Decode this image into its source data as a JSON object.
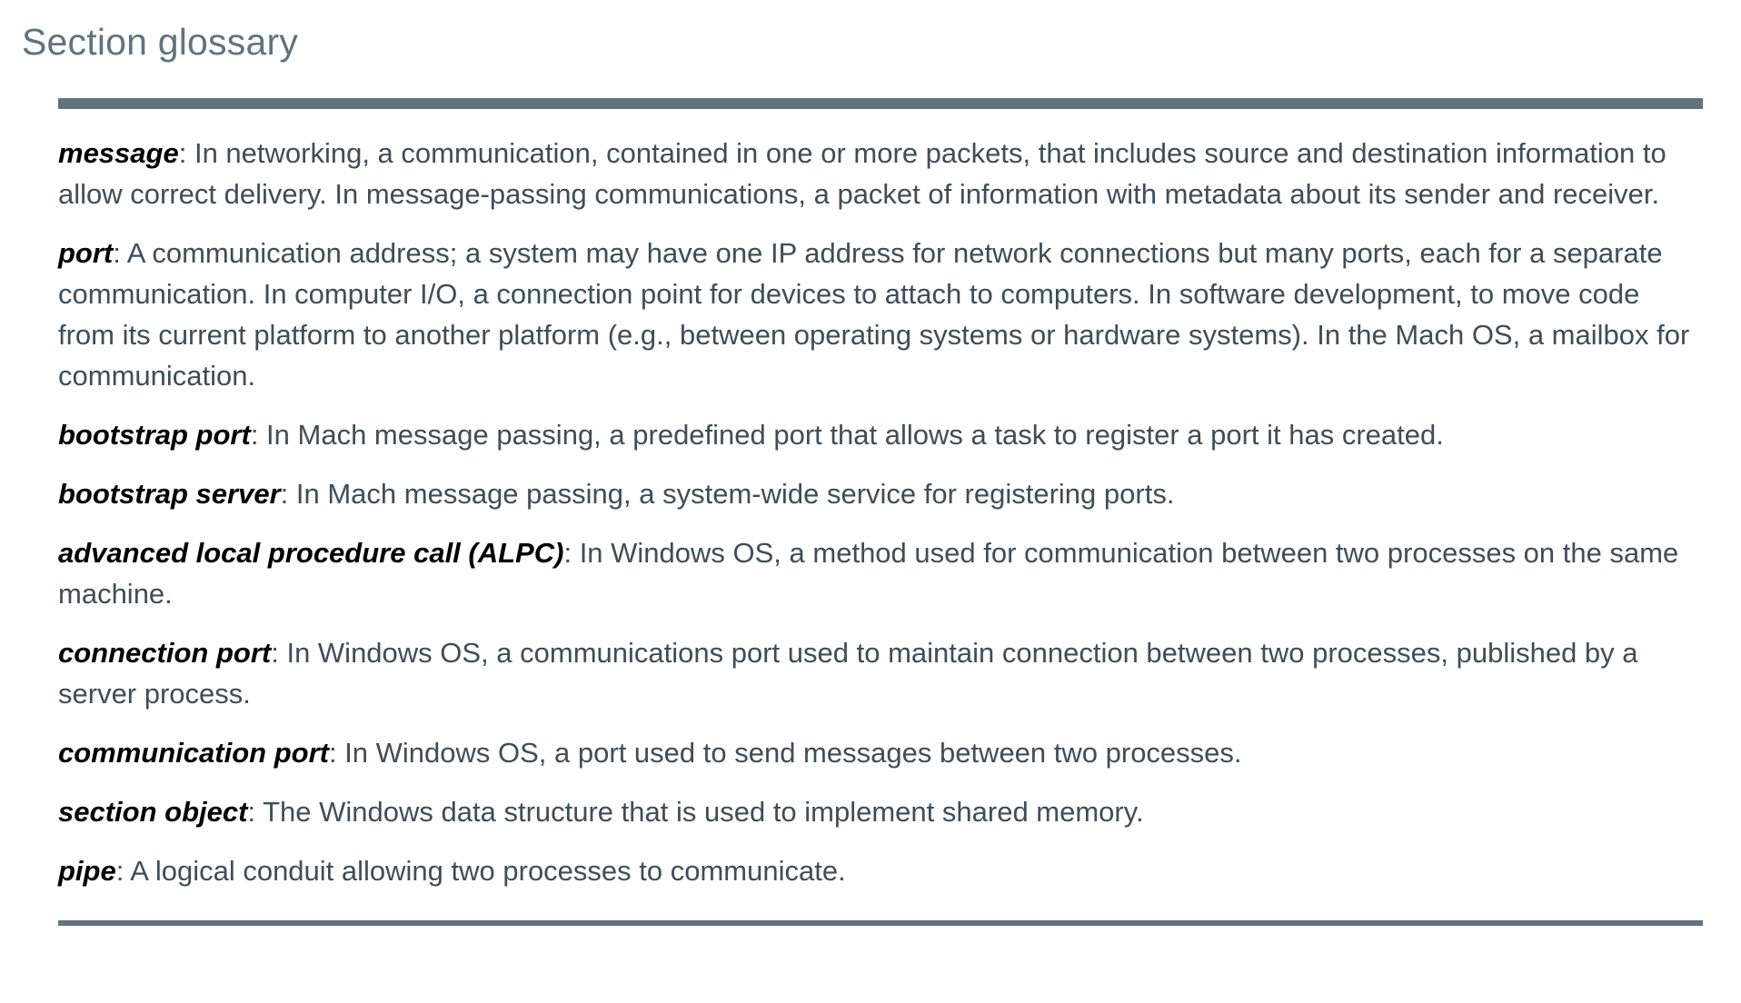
{
  "section": {
    "title": "Section glossary"
  },
  "glossary": {
    "separator": ": ",
    "entries": [
      {
        "term": "message",
        "definition": "In networking, a communication, contained in one or more packets, that includes source and destination information to allow correct delivery. In message-passing communications, a packet of information with metadata about its sender and receiver."
      },
      {
        "term": "port",
        "definition": "A communication address; a system may have one IP address for network connections but many ports, each for a separate communication. In computer I/O, a connection point for devices to attach to computers. In software development, to move code from its current platform to another platform (e.g., between operating systems or hardware systems). In the Mach OS, a mailbox for communication."
      },
      {
        "term": "bootstrap port",
        "definition": "In Mach message passing, a predefined port that allows a task to register a port it has created."
      },
      {
        "term": "bootstrap server",
        "definition": "In Mach message passing, a system-wide service for registering ports."
      },
      {
        "term": "advanced local procedure call (ALPC)",
        "definition": "In Windows OS, a method used for communication between two processes on the same machine."
      },
      {
        "term": "connection port",
        "definition": "In Windows OS, a communications port used to maintain connection between two processes, published by a server process."
      },
      {
        "term": "communication port",
        "definition": "In Windows OS, a port used to send messages between two processes."
      },
      {
        "term": "section object",
        "definition": "The Windows data structure that is used to implement shared memory."
      },
      {
        "term": "pipe",
        "definition": "A logical conduit allowing two processes to communicate."
      }
    ]
  },
  "colors": {
    "title": "#5f7381",
    "rule": "#5f7381",
    "body_text": "#3e4d59",
    "term_text": "#000000",
    "background": "#ffffff"
  }
}
